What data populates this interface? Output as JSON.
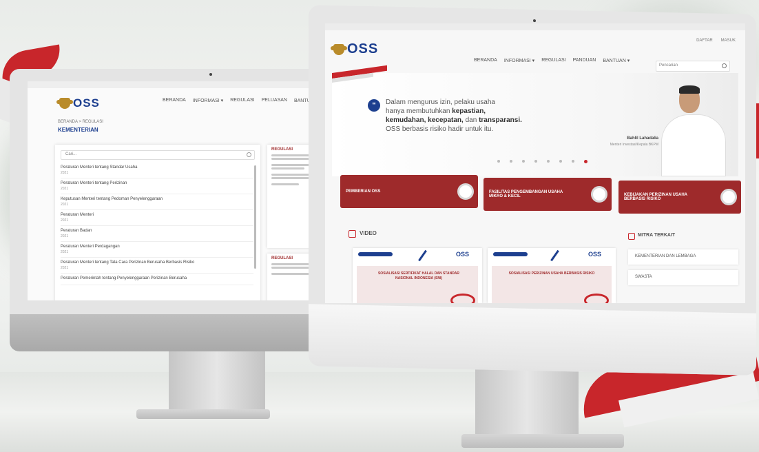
{
  "left_screen": {
    "logo_text": "OSS",
    "nav": [
      "BERANDA",
      "INFORMASI ▾",
      "REGULASI",
      "PELUASAN",
      "BANTUAN ▾"
    ],
    "breadcrumb": "BERANDA > REGULASI",
    "page_title": "KEMENTERIAN",
    "search_placeholder": "Cari...",
    "list_items": [
      {
        "title": "Peraturan Menteri tentang Standar Usaha",
        "date": "2021"
      },
      {
        "title": "Peraturan Menteri tentang Perizinan",
        "date": "2021"
      },
      {
        "title": "Keputusan Menteri tentang Pedoman Penyelenggaraan",
        "date": "2021"
      },
      {
        "title": "Peraturan Menteri",
        "date": "2021"
      },
      {
        "title": "Peraturan Badan",
        "date": "2021"
      },
      {
        "title": "Peraturan Menteri Perdagangan",
        "date": "2021"
      },
      {
        "title": "Peraturan Menteri tentang Tata Cara Perizinan Berusaha Berbasis Risiko",
        "date": "2021"
      },
      {
        "title": "Peraturan Pemerintah tentang Penyelenggaraan Perizinan Berusaha",
        "date": ""
      }
    ],
    "side_heading_1": "REGULASI",
    "side_heading_2": "REGULASI"
  },
  "right_screen": {
    "logo_text": "OSS",
    "top_links": [
      "DAFTAR",
      "MASUK"
    ],
    "nav": [
      "BERANDA",
      "INFORMASI ▾",
      "REGULASI",
      "PANDUAN",
      "BANTUAN ▾"
    ],
    "search_placeholder": "Pencarian",
    "hero": {
      "quote_plain_1": "Dalam mengurus izin, pelaku usaha",
      "quote_plain_2": "hanya membutuhkan ",
      "quote_bold_1": "kepastian,",
      "quote_bold_2": "kemudahan, kecepatan,",
      "quote_plain_3": " dan ",
      "quote_bold_3": "transparansi.",
      "quote_plain_4": "OSS berbasis risiko hadir untuk itu.",
      "person_name": "Bahlil Lahadalia",
      "person_title": "Menteri Investasi/Kepala BKPM"
    },
    "cards": [
      "PEMBERIAN OSS",
      "FASILITAS PENGEMBANGAN USAHA MIKRO & KECIL",
      "KEBIJAKAN PERIZINAN USAHA BERBASIS RISIKO"
    ],
    "video_heading": "VIDEO",
    "videos": [
      {
        "logo": "OSS",
        "title": "SOSIALISASI SERTIFIKAT HALAL DAN STANDAR NASIONAL INDONESIA (SNI)"
      },
      {
        "logo": "OSS",
        "title": "SOSIALISASI PERIZINAN USAHA BERBASIS RISIKO"
      }
    ],
    "partner_heading": "MITRA TERKAIT",
    "partners": [
      "KEMENTERIAN DAN LEMBAGA",
      "SWASTA"
    ]
  },
  "colors": {
    "brand_red": "#9e2a2b",
    "brand_blue": "#1d3f8f",
    "ribbon_red": "#c8262b"
  }
}
